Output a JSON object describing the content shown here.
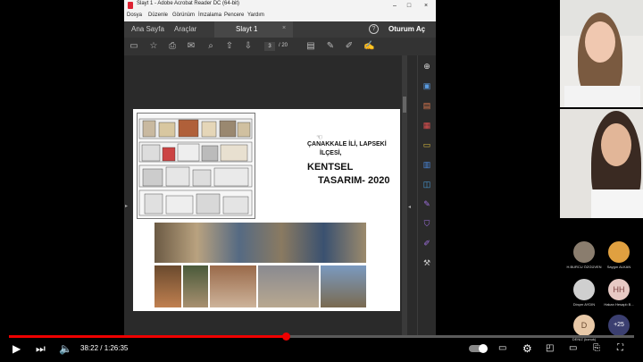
{
  "acrobat": {
    "window_title": "Slayt 1 - Adobe Acrobat Reader DC (64-bit)",
    "window_controls": [
      "–",
      "□",
      "×"
    ],
    "menu": [
      "Dosya",
      "Düzenle",
      "Görünüm",
      "İmzalama",
      "Pencere",
      "Yardım"
    ],
    "tabs": {
      "home": "Ana Sayfa",
      "tools": "Araçlar",
      "document": "Slayt 1"
    },
    "help": "?",
    "login": "Oturum Aç",
    "page_current": "3",
    "page_total": "/ 20"
  },
  "slide": {
    "subtitle_line1": "ÇANAKKALE İLİ, LAPSEKİ",
    "subtitle_line2": "İLÇESİ,",
    "title_line1": "KENTSEL",
    "title_line2": "TASARIM- 2020"
  },
  "participants": [
    {
      "name": "H.BURCU ÖZGÜVEN",
      "initials": "",
      "color": "#8a7d6e"
    },
    {
      "name": "Saygın ALKAN",
      "initials": "",
      "color": "#e0a040"
    },
    {
      "name": "Dinçer AYDIN",
      "initials": "",
      "color": "#cfcfcf"
    },
    {
      "name": "Hakan Hesaplı B...",
      "initials": "HH",
      "color": "#e7c9c4"
    },
    {
      "name": "DENİZ (konuk)",
      "initials": "D",
      "color": "#e8c9a8"
    },
    {
      "name": "",
      "initials": "+25",
      "color": "#3b3f70"
    }
  ],
  "player": {
    "time": "38:22 / 1:26:35",
    "progress": 0.443
  },
  "icons": {
    "play": "play-icon",
    "next": "next-icon",
    "volume": "volume-icon"
  }
}
